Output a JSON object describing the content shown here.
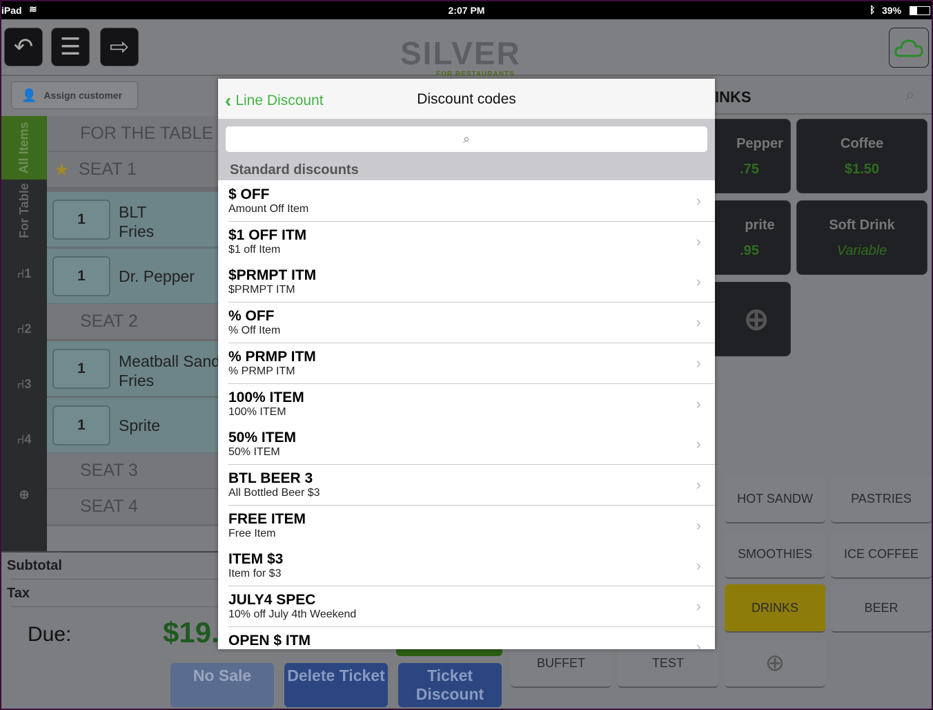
{
  "status_bar": {
    "device": "iPad",
    "time": "2:07 PM",
    "battery": "39%"
  },
  "header": {
    "logo": "SILVER",
    "logo_sub": "FOR RESTAURANTS",
    "buttons": [
      "back-icon",
      "menu-icon",
      "exit-icon"
    ],
    "cloud": "cloud-icon"
  },
  "assign_customer": "Assign customer",
  "left_tabs": {
    "all_items": "All Items",
    "for_table": "For Table",
    "seats": [
      "1",
      "2",
      "3",
      "4"
    ]
  },
  "order": {
    "for_table": "FOR THE TABLE",
    "seat1": "SEAT 1",
    "seat2": "SEAT 2",
    "seat3": "SEAT 3",
    "seat4": "SEAT 4",
    "items": [
      {
        "qty": "1",
        "name": "BLT",
        "mod": "Fries"
      },
      {
        "qty": "1",
        "name": "Dr. Pepper",
        "mod": ""
      },
      {
        "qty": "1",
        "name": "Meatball Sandwich",
        "mod": "Fries"
      },
      {
        "qty": "1",
        "name": "Sprite",
        "mod": ""
      }
    ]
  },
  "totals": {
    "subtotal": "Subtotal",
    "tax": "Tax",
    "due_label": "Due:",
    "due_value": "$19."
  },
  "bottom_buttons": {
    "no_sale": "No Sale",
    "delete_ticket": "Delete Ticket",
    "ticket_discount": "Ticket Discount"
  },
  "category_title": "INKS",
  "products": [
    {
      "name": "Pepper",
      "price": ".75"
    },
    {
      "name": "Coffee",
      "price": "$1.50"
    },
    {
      "name": "prite",
      "price": ".95"
    },
    {
      "name": "Soft Drink",
      "price": "Variable"
    }
  ],
  "categories": [
    "HOT SANDW",
    "PASTRIES",
    "SMOOTHIES",
    "ICE COFFEE",
    "DRINKS",
    "BEER",
    "BUFFET",
    "TEST"
  ],
  "colors": {
    "accent": "#45b344",
    "selected_category": "#c8b000",
    "due": "#1f7a1f"
  },
  "popover": {
    "back_label": "Line Discount",
    "title": "Discount codes",
    "search_placeholder": "",
    "section": "Standard discounts",
    "discounts": [
      {
        "code": "$ OFF",
        "desc": "Amount Off Item"
      },
      {
        "code": "$1 OFF ITM",
        "desc": "$1 off Item"
      },
      {
        "code": "$PRMPT ITM",
        "desc": "$PRMPT ITM"
      },
      {
        "code": "% OFF",
        "desc": "% Off Item"
      },
      {
        "code": "% PRMP ITM",
        "desc": "% PRMP ITM"
      },
      {
        "code": "100% ITEM",
        "desc": "100% ITEM"
      },
      {
        "code": "50% ITEM",
        "desc": "50% ITEM"
      },
      {
        "code": "BTL BEER 3",
        "desc": "All Bottled Beer $3"
      },
      {
        "code": "FREE ITEM",
        "desc": "Free Item"
      },
      {
        "code": "ITEM $3",
        "desc": "Item for $3"
      },
      {
        "code": "JULY4 SPEC",
        "desc": "10% off July 4th Weekend"
      },
      {
        "code": "OPEN $ ITM",
        "desc": ""
      }
    ]
  }
}
